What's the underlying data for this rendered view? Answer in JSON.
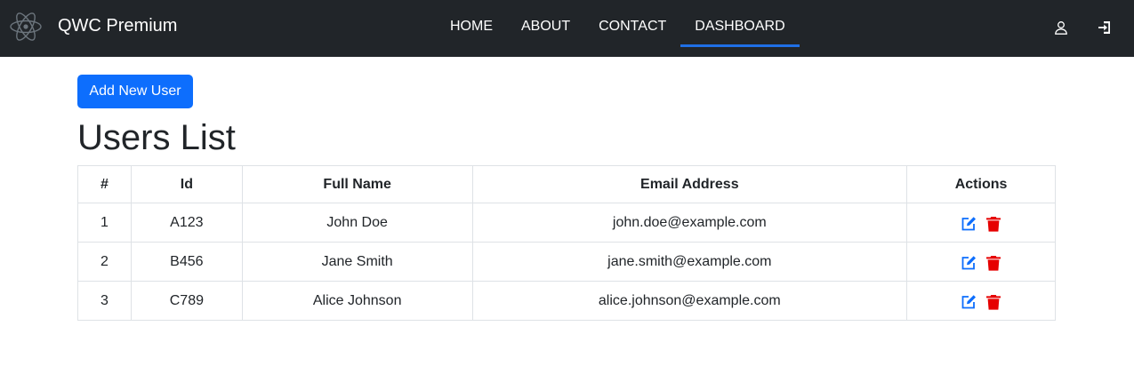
{
  "colors": {
    "navbar_bg": "#212529",
    "accent": "#0d6efd",
    "edit_icon": "#0d6efd",
    "delete_icon": "#e60000"
  },
  "brand": {
    "logo_icon": "react-atom-icon",
    "name": "QWC Premium"
  },
  "nav": {
    "items": [
      {
        "label": "HOME",
        "active": false
      },
      {
        "label": "ABOUT",
        "active": false
      },
      {
        "label": "CONTACT",
        "active": false
      },
      {
        "label": "DASHBOARD",
        "active": true
      }
    ],
    "user_icon": "user-icon",
    "logout_icon": "logout-icon"
  },
  "main": {
    "add_button_label": "Add New User",
    "title": "Users List",
    "table": {
      "headers": [
        "#",
        "Id",
        "Full Name",
        "Email Address",
        "Actions"
      ],
      "rows": [
        {
          "num": "1",
          "id": "A123",
          "full_name": "John Doe",
          "email": "john.doe@example.com"
        },
        {
          "num": "2",
          "id": "B456",
          "full_name": "Jane Smith",
          "email": "jane.smith@example.com"
        },
        {
          "num": "3",
          "id": "C789",
          "full_name": "Alice Johnson",
          "email": "alice.johnson@example.com"
        }
      ],
      "action_icons": [
        "edit-icon",
        "trash-icon"
      ]
    }
  }
}
